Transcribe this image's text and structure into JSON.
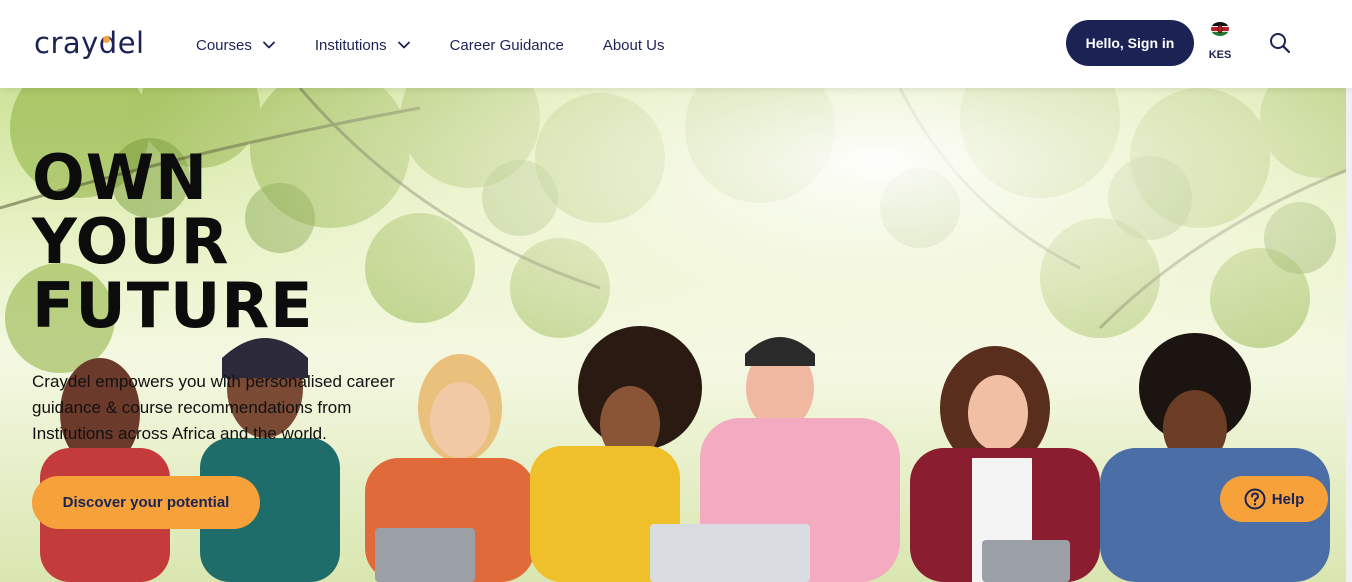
{
  "brand": {
    "logo_text": "craydel",
    "accent": "#f7a13a",
    "primary": "#1b2354"
  },
  "nav": {
    "items": [
      {
        "label": "Courses",
        "has_dropdown": true
      },
      {
        "label": "Institutions",
        "has_dropdown": true
      },
      {
        "label": "Career Guidance",
        "has_dropdown": false
      },
      {
        "label": "About Us",
        "has_dropdown": false
      }
    ]
  },
  "header": {
    "signin_label": "Hello, Sign in",
    "currency_label": "KES",
    "flag_icon": "kenya-flag-icon",
    "search_icon": "search-icon"
  },
  "hero": {
    "headline_lines": [
      "OWN",
      "YOUR",
      "FUTURE"
    ],
    "subcopy": "Craydel empowers you with personalised career guidance & course recommendations from Institutions across Africa and the world.",
    "cta_label": "Discover your potential"
  },
  "help": {
    "label": "Help",
    "icon": "question-circle-icon"
  }
}
